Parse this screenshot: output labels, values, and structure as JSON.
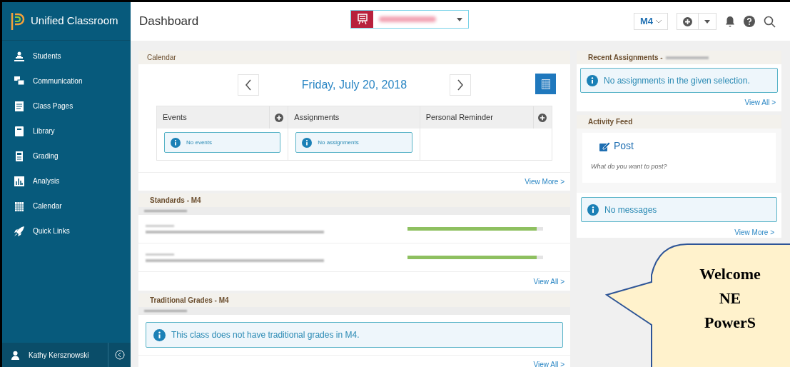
{
  "app": {
    "title": "Unified Classroom"
  },
  "sidebar": {
    "items": [
      {
        "label": "Students"
      },
      {
        "label": "Communication"
      },
      {
        "label": "Class Pages"
      },
      {
        "label": "Library"
      },
      {
        "label": "Grading"
      },
      {
        "label": "Analysis"
      },
      {
        "label": "Calendar"
      },
      {
        "label": "Quick Links"
      }
    ]
  },
  "user": {
    "name": "Kathy Kersznowski"
  },
  "header": {
    "title": "Dashboard",
    "term": "M4"
  },
  "calendar": {
    "title": "Calendar",
    "date": "Friday, July 20, 2018",
    "columns": [
      {
        "label": "Events",
        "addable": true,
        "message": "No events"
      },
      {
        "label": "Assignments",
        "addable": false,
        "message": "No assignments"
      },
      {
        "label": "Personal Reminder",
        "addable": true
      }
    ],
    "link": "View More >"
  },
  "standards": {
    "title": "Standards - M4",
    "rows": [
      {
        "level": 0.95
      },
      {
        "level": 0.95
      }
    ],
    "link": "View All >"
  },
  "traditional_grades": {
    "title": "Traditional Grades - M4",
    "message": "This class does not have traditional grades in M4.",
    "link": "View All >"
  },
  "recent_assignments": {
    "title": "Recent Assignments -",
    "message": "No assignments in the given selection.",
    "link": "View All >"
  },
  "activity_feed": {
    "title": "Activity Feed",
    "post_label": "Post",
    "placeholder": "What do you want to post?",
    "message": "No messages",
    "link": "View More >"
  },
  "callout": {
    "lines": [
      "Welcome",
      "NE",
      "PowerS"
    ]
  }
}
